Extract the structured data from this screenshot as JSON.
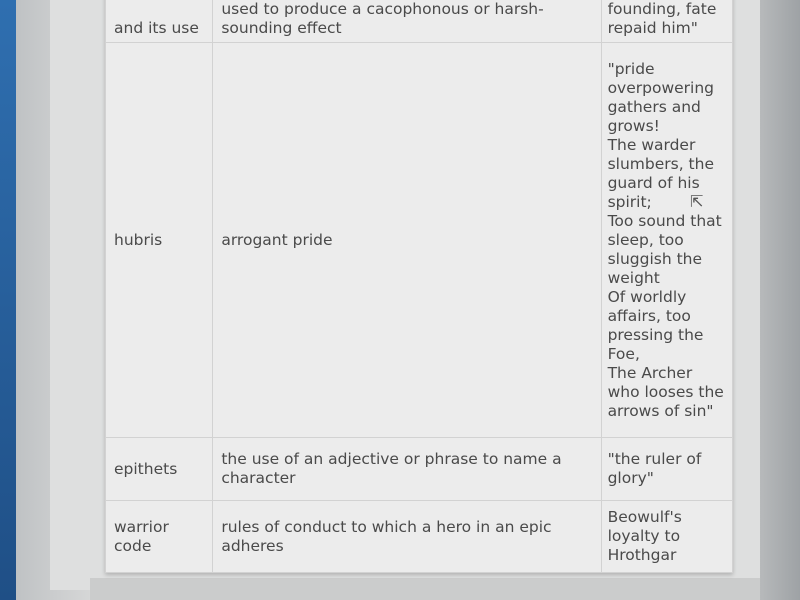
{
  "table": {
    "rows": [
      {
        "term": "and its use",
        "definition": "used to produce a cacophonous or harsh-sounding effect",
        "example": "founding, fate repaid him\""
      },
      {
        "term": "hubris",
        "definition": "arrogant pride",
        "example": "\"pride overpowering gathers and grows!\nThe warder slumbers, the guard of his spirit;\nToo sound that sleep, too sluggish the weight\nOf worldly affairs, too pressing the Foe,\nThe Archer who looses the arrows of sin\""
      },
      {
        "term": "epithets",
        "definition": "the use of an adjective or phrase to name a character",
        "example": "\"the ruler of glory\""
      },
      {
        "term": "warrior code",
        "definition": "rules of conduct to which a hero in an epic adheres",
        "example": "Beowulf's loyalty to Hrothgar"
      }
    ]
  },
  "cursor_icon": "pointer-arrow"
}
